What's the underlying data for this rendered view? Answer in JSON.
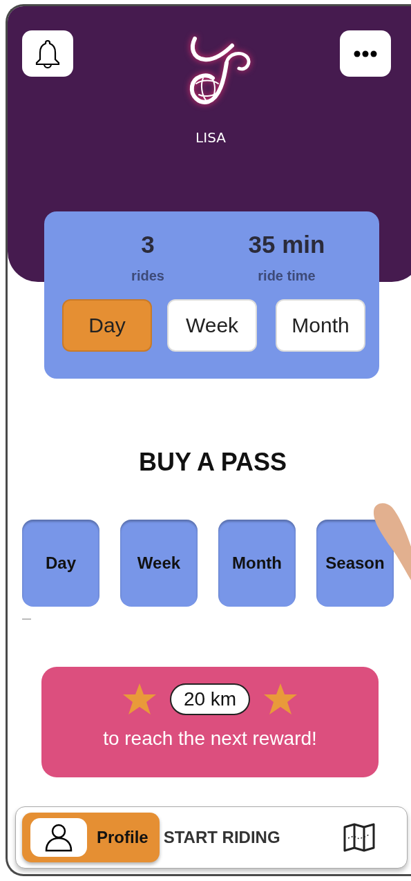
{
  "header": {
    "name": "LISA"
  },
  "stats": [
    {
      "value": "3",
      "label": "rides"
    },
    {
      "value": "35 min",
      "label": "ride time"
    }
  ],
  "period_tabs": [
    {
      "label": "Day",
      "selected": true
    },
    {
      "label": "Week",
      "selected": false
    },
    {
      "label": "Month",
      "selected": false
    }
  ],
  "passes": {
    "title": "BUY A PASS",
    "options": [
      "Day",
      "Week",
      "Month",
      "Season"
    ]
  },
  "reward": {
    "distance": "20 km",
    "message": "to reach the next reward!"
  },
  "nav": [
    {
      "kind": "profile",
      "label": "Profile",
      "selected": true
    },
    {
      "kind": "start",
      "label": "START RIDING",
      "selected": false
    },
    {
      "kind": "map",
      "selected": false
    }
  ]
}
